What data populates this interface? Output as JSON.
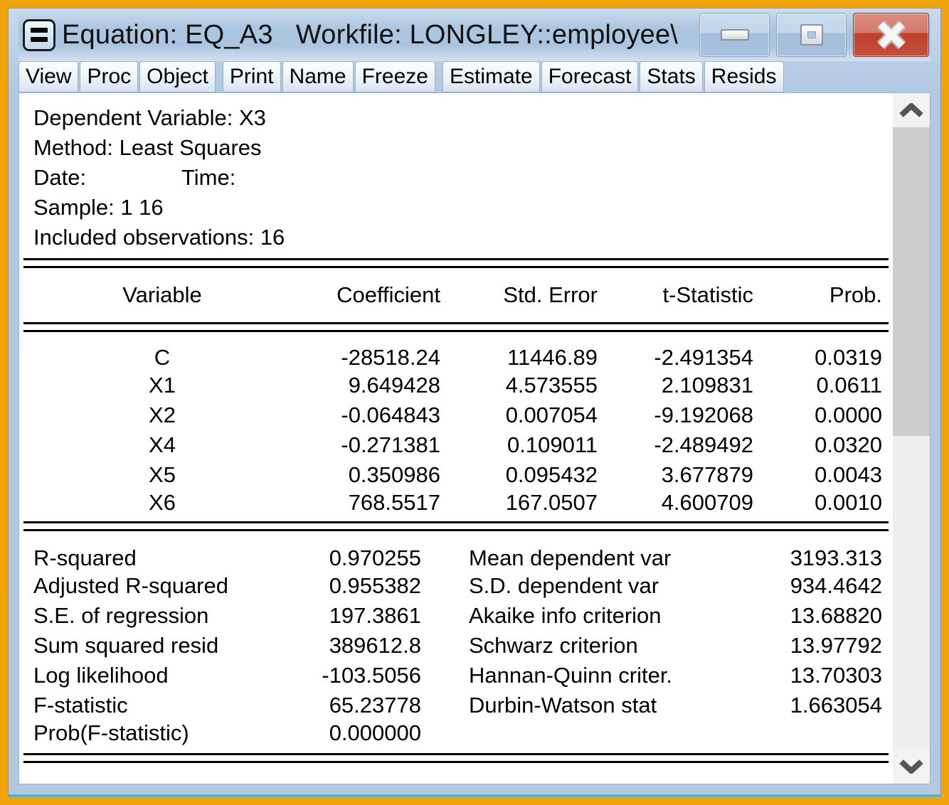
{
  "window": {
    "title": "Equation: EQ_A3   Workfile: LONGLEY::employee\\",
    "icon": "equation-object-icon",
    "controls": [
      "minimize",
      "maximize",
      "close"
    ]
  },
  "colors": {
    "frame_accent": "#f0a30a",
    "titlebar_blue": "#b3c9e2",
    "close_red": "#c0432f",
    "text": "#000000"
  },
  "icons": {
    "window_icon": "equation-equals-icon",
    "minimize": "minimize-bar",
    "maximize": "restore-square",
    "close": "close-x",
    "scroll_up": "chevron-up",
    "scroll_down": "chevron-down"
  },
  "toolbar": {
    "groups": [
      {
        "buttons": [
          "View",
          "Proc",
          "Object"
        ]
      },
      {
        "buttons": [
          "Print",
          "Name",
          "Freeze"
        ]
      },
      {
        "buttons": [
          "Estimate",
          "Forecast",
          "Stats",
          "Resids"
        ]
      }
    ]
  },
  "summary": {
    "dependent_variable": "Dependent Variable: X3",
    "method": "Method: Least Squares",
    "date_label": "Date:",
    "time_label": "Time:",
    "sample": "Sample: 1 16",
    "included_observations": "Included observations: 16"
  },
  "coefficients_table": {
    "headers": [
      "Variable",
      "Coefficient",
      "Std. Error",
      "t-Statistic",
      "Prob."
    ],
    "rows": [
      {
        "variable": "C",
        "coefficient": "-28518.24",
        "std_error": "11446.89",
        "t_statistic": "-2.491354",
        "prob": "0.0319"
      },
      {
        "variable": "X1",
        "coefficient": "9.649428",
        "std_error": "4.573555",
        "t_statistic": "2.109831",
        "prob": "0.0611"
      },
      {
        "variable": "X2",
        "coefficient": "-0.064843",
        "std_error": "0.007054",
        "t_statistic": "-9.192068",
        "prob": "0.0000"
      },
      {
        "variable": "X4",
        "coefficient": "-0.271381",
        "std_error": "0.109011",
        "t_statistic": "-2.489492",
        "prob": "0.0320"
      },
      {
        "variable": "X5",
        "coefficient": "0.350986",
        "std_error": "0.095432",
        "t_statistic": "3.677879",
        "prob": "0.0043"
      },
      {
        "variable": "X6",
        "coefficient": "768.5517",
        "std_error": "167.0507",
        "t_statistic": "4.600709",
        "prob": "0.0010"
      }
    ]
  },
  "statistics": {
    "left": [
      {
        "label": "R-squared",
        "value": "0.970255"
      },
      {
        "label": "Adjusted R-squared",
        "value": "0.955382"
      },
      {
        "label": "S.E. of regression",
        "value": "197.3861"
      },
      {
        "label": "Sum squared resid",
        "value": "389612.8"
      },
      {
        "label": "Log likelihood",
        "value": "-103.5056"
      },
      {
        "label": "F-statistic",
        "value": "65.23778"
      },
      {
        "label": "Prob(F-statistic)",
        "value": "0.000000"
      }
    ],
    "right": [
      {
        "label": "Mean dependent var",
        "value": "3193.313"
      },
      {
        "label": "S.D. dependent var",
        "value": "934.4642"
      },
      {
        "label": "Akaike info criterion",
        "value": "13.68820"
      },
      {
        "label": "Schwarz criterion",
        "value": "13.97792"
      },
      {
        "label": "Hannan-Quinn criter.",
        "value": "13.70303"
      },
      {
        "label": "Durbin-Watson stat",
        "value": "1.663054"
      }
    ]
  }
}
